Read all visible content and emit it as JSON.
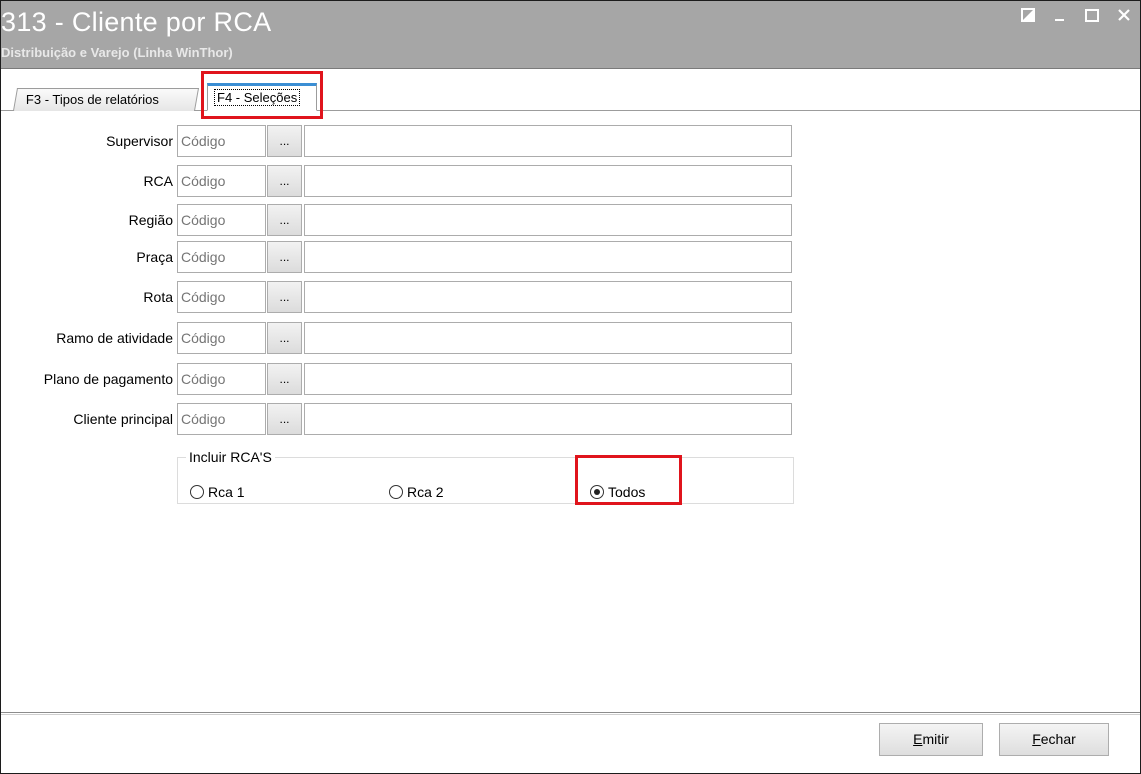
{
  "window": {
    "title": "313 - Cliente por RCA",
    "subtitle": "Distribuição e Varejo (Linha WinThor)"
  },
  "tabs": [
    {
      "label": "F3 - Tipos de relatórios",
      "active": false
    },
    {
      "label": "F4 - Seleções",
      "active": true
    }
  ],
  "filters": [
    {
      "label": "Supervisor",
      "placeholder": "Código",
      "button": "..."
    },
    {
      "label": "RCA",
      "placeholder": "Código",
      "button": "..."
    },
    {
      "label": "Região",
      "placeholder": "Código",
      "button": "..."
    },
    {
      "label": "Praça",
      "placeholder": "Código",
      "button": "..."
    },
    {
      "label": "Rota",
      "placeholder": "Código",
      "button": "..."
    },
    {
      "label": "Ramo de atividade",
      "placeholder": "Código",
      "button": "..."
    },
    {
      "label": "Plano de pagamento",
      "placeholder": "Código",
      "button": "..."
    },
    {
      "label": "Cliente principal",
      "placeholder": "Código",
      "button": "..."
    }
  ],
  "rca_group": {
    "title": "Incluir RCA'S",
    "options": [
      {
        "label": "Rca 1",
        "selected": false
      },
      {
        "label": "Rca 2",
        "selected": false
      },
      {
        "label": "Todos",
        "selected": true
      }
    ]
  },
  "buttons": {
    "emitir_hotkey": "E",
    "emitir_rest": "mitir",
    "fechar_hotkey": "F",
    "fechar_rest": "echar"
  },
  "colors": {
    "titlebar": "#a6a6a6",
    "highlight": "#e0141c",
    "active_tab_accent": "#3b8ed4"
  }
}
